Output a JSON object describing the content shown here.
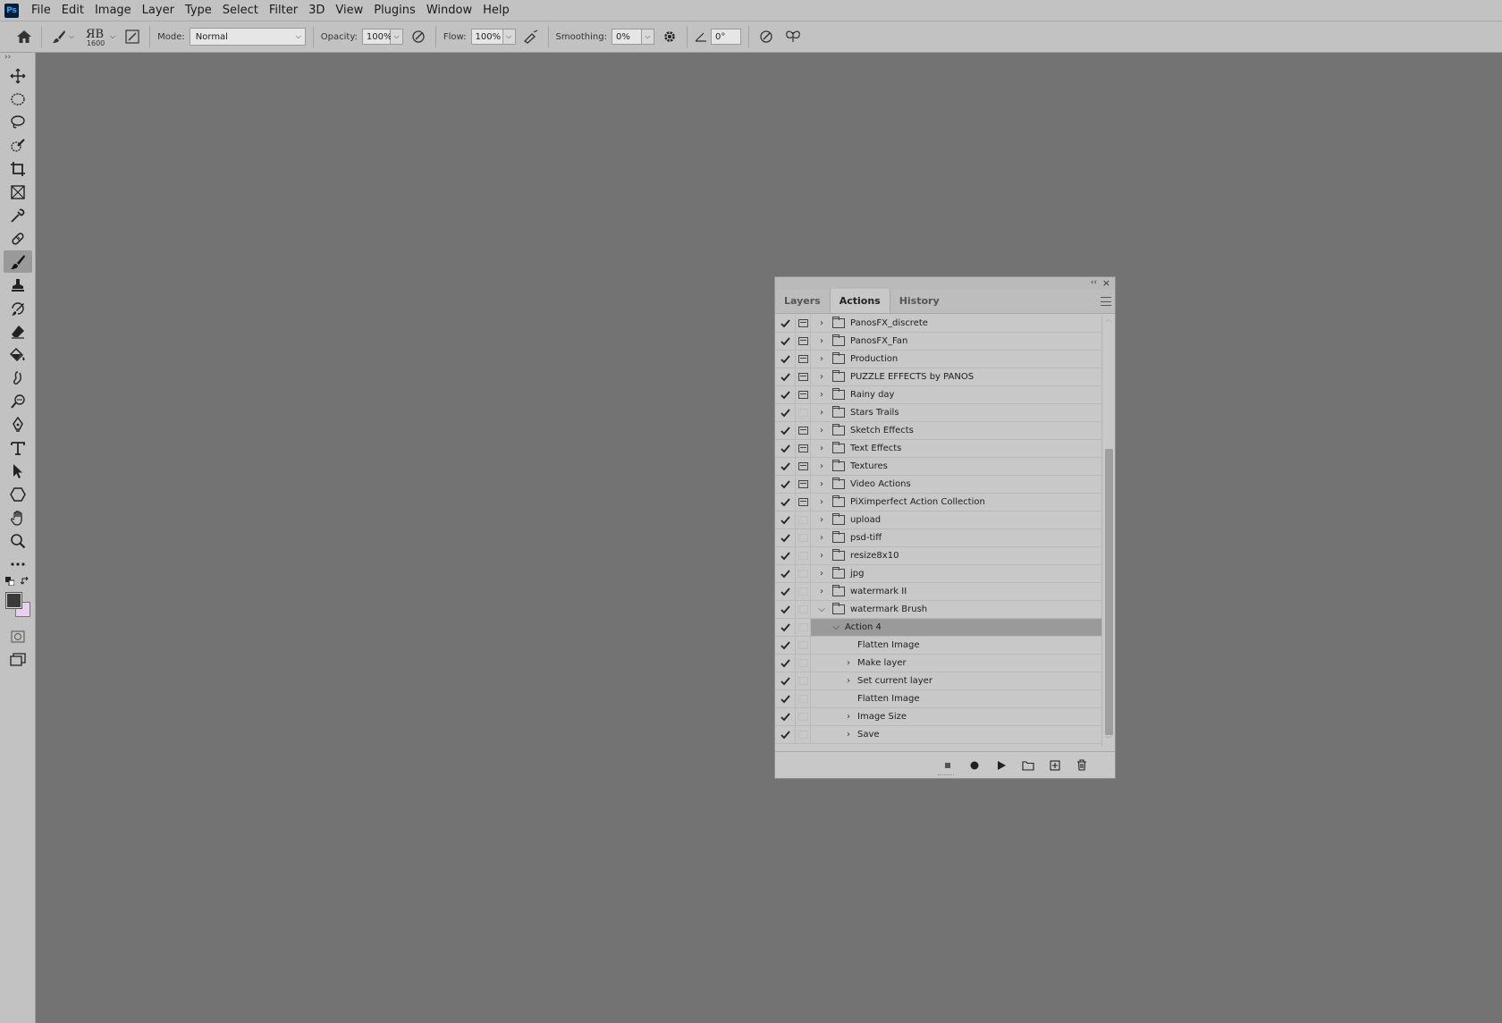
{
  "menubar": {
    "logo": "Ps",
    "items": [
      "File",
      "Edit",
      "Image",
      "Layer",
      "Type",
      "Select",
      "Filter",
      "3D",
      "View",
      "Plugins",
      "Window",
      "Help"
    ]
  },
  "options": {
    "brush_size": "1600",
    "mode_label": "Mode:",
    "mode_value": "Normal",
    "opacity_label": "Opacity:",
    "opacity_value": "100%",
    "flow_label": "Flow:",
    "flow_value": "100%",
    "smoothing_label": "Smoothing:",
    "smoothing_value": "0%",
    "angle_value": "0°"
  },
  "colors": {
    "foreground": "#3a3a3a",
    "background": "#e7d0f0"
  },
  "panel": {
    "tabs": [
      "Layers",
      "Actions",
      "History"
    ],
    "active_tab": "Actions",
    "rows": [
      {
        "label": "PanosFX_discrete",
        "dialog": true,
        "type": "set",
        "expanded": false
      },
      {
        "label": "PanosFX_Fan",
        "dialog": true,
        "type": "set",
        "expanded": false
      },
      {
        "label": "Production",
        "dialog": true,
        "type": "set",
        "expanded": false
      },
      {
        "label": "PUZZLE EFFECTS by PANOS",
        "dialog": true,
        "type": "set",
        "expanded": false
      },
      {
        "label": "Rainy day",
        "dialog": true,
        "type": "set",
        "expanded": false
      },
      {
        "label": "Stars Trails",
        "dialog": false,
        "type": "set",
        "expanded": false
      },
      {
        "label": "Sketch Effects",
        "dialog": true,
        "type": "set",
        "expanded": false
      },
      {
        "label": "Text Effects",
        "dialog": true,
        "type": "set",
        "expanded": false
      },
      {
        "label": "Textures",
        "dialog": true,
        "type": "set",
        "expanded": false
      },
      {
        "label": "Video Actions",
        "dialog": true,
        "type": "set",
        "expanded": false
      },
      {
        "label": "PiXimperfect Action Collection",
        "dialog": true,
        "type": "set",
        "expanded": false
      },
      {
        "label": "upload",
        "dialog": false,
        "type": "set",
        "expanded": false
      },
      {
        "label": "psd-tiff",
        "dialog": false,
        "type": "set",
        "expanded": false
      },
      {
        "label": "resize8x10",
        "dialog": false,
        "type": "set",
        "expanded": false
      },
      {
        "label": "jpg",
        "dialog": false,
        "type": "set",
        "expanded": false
      },
      {
        "label": "watermark II",
        "dialog": false,
        "type": "set",
        "expanded": false
      },
      {
        "label": "watermark Brush",
        "dialog": false,
        "type": "set",
        "expanded": true
      },
      {
        "label": "Action 4",
        "dialog": false,
        "type": "action",
        "expanded": true,
        "selected": true
      },
      {
        "label": "Flatten Image",
        "dialog": false,
        "type": "step",
        "has_arrow": false
      },
      {
        "label": "Make layer",
        "dialog": false,
        "type": "step",
        "has_arrow": true
      },
      {
        "label": "Set current layer",
        "dialog": false,
        "type": "step",
        "has_arrow": true
      },
      {
        "label": "Flatten Image",
        "dialog": false,
        "type": "step",
        "has_arrow": false
      },
      {
        "label": "Image Size",
        "dialog": false,
        "type": "step",
        "has_arrow": true
      },
      {
        "label": "Save",
        "dialog": false,
        "type": "step",
        "has_arrow": true
      }
    ]
  }
}
